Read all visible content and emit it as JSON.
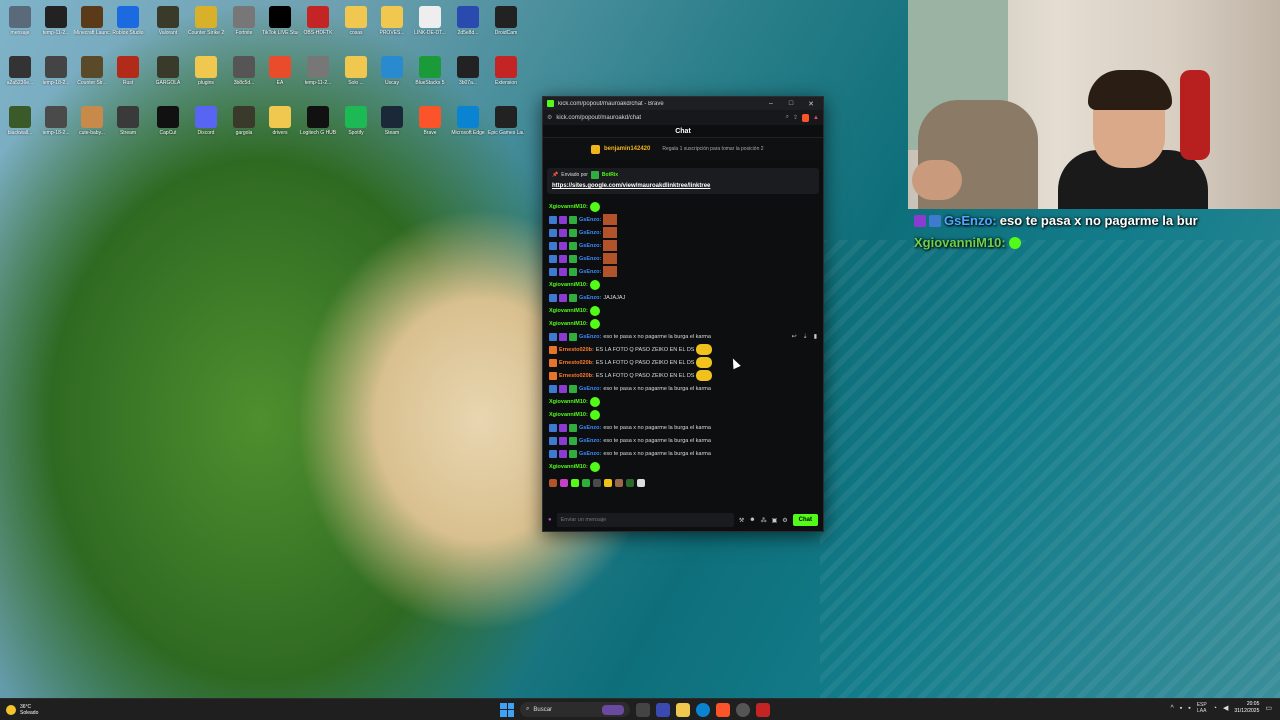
{
  "desktop": {
    "icons": [
      {
        "label": "mensaje",
        "color": "#5a6a7a"
      },
      {
        "label": "temp-11-2...",
        "color": "#222222"
      },
      {
        "label": "Minecraft Launcher",
        "color": "#5b3a1a"
      },
      {
        "label": "Roblox Studio",
        "color": "#1b6ae0"
      },
      {
        "label": "Valorant",
        "color": "#3a3a2a"
      },
      {
        "label": "Counter Strike 2",
        "color": "#d8b02a"
      },
      {
        "label": "Fortnite",
        "color": "#777777"
      },
      {
        "label": "TikTok LIVE Studio",
        "color": "#000000"
      },
      {
        "label": "OBS-HDFTK",
        "color": "#c42424"
      },
      {
        "label": "cosas",
        "color": "#f0c850"
      },
      {
        "label": "PROVES...",
        "color": "#f0c850"
      },
      {
        "label": "LINK-DE-DT...",
        "color": "#eeeeee"
      },
      {
        "label": "2d5e8d...",
        "color": "#2a4ab0"
      },
      {
        "label": "DroidCam",
        "color": "#222222"
      },
      {
        "label": "a2a5236e...",
        "color": "#333333"
      },
      {
        "label": "temp-18-2...",
        "color": "#444444"
      },
      {
        "label": "Counter Str...",
        "color": "#5a4a2a"
      },
      {
        "label": "Rust",
        "color": "#b22a1a"
      },
      {
        "label": "GARGOLA",
        "color": "#3a3a2a"
      },
      {
        "label": "plugins",
        "color": "#f0c850"
      },
      {
        "label": "3b8c5d...",
        "color": "#555555"
      },
      {
        "label": "EA",
        "color": "#e84c2a"
      },
      {
        "label": "temp-11-2...",
        "color": "#777777"
      },
      {
        "label": "Solo ...",
        "color": "#f0c850"
      },
      {
        "label": "Uscay",
        "color": "#2a8ad0"
      },
      {
        "label": "BlueStacks 5",
        "color": "#1b9a3a"
      },
      {
        "label": "3b07a...",
        "color": "#222222"
      },
      {
        "label": "Extension",
        "color": "#c42424"
      },
      {
        "label": "blackwall...",
        "color": "#3a5a2a"
      },
      {
        "label": "temp-18-2...",
        "color": "#4a4a4a"
      },
      {
        "label": "cute-baby...",
        "color": "#c88a4a"
      },
      {
        "label": "Stream",
        "color": "#3a3a3a"
      },
      {
        "label": "CapCut",
        "color": "#111111"
      },
      {
        "label": "Discord",
        "color": "#5865f2"
      },
      {
        "label": "gargola",
        "color": "#3a3a2a"
      },
      {
        "label": "drivers",
        "color": "#f0c850"
      },
      {
        "label": "Logitech G HUB",
        "color": "#111111"
      },
      {
        "label": "Spotify",
        "color": "#1db954"
      },
      {
        "label": "Steam",
        "color": "#1b2838"
      },
      {
        "label": "Brave",
        "color": "#fb542b"
      },
      {
        "label": "Microsoft Edge",
        "color": "#0a84d0"
      },
      {
        "label": "Epic Games Launcher",
        "color": "#222222"
      }
    ]
  },
  "webcam": {
    "overlay_lines": [
      {
        "user": "GsEnzo:",
        "text": "eso te pasa x no pagarme la bur"
      },
      {
        "user": "XgiovanniM10:",
        "text": ""
      }
    ]
  },
  "browser": {
    "title": "kick.com/popout/mauroakd/chat - Brave",
    "url": "kick.com/popout/mauroakd/chat",
    "controls": {
      "minimize": "–",
      "maximize": "□",
      "close": "✕"
    }
  },
  "chat": {
    "header": "Chat",
    "goal": {
      "user": "benjamin142420",
      "text": "Regala 1 suscripción para tomar la posición 2"
    },
    "pinned": {
      "by_label": "Enviado por",
      "bot": "BotRix",
      "link": "https://sites.google.com/view/mauroakdlinktree/linktree"
    },
    "messages": [
      {
        "user": "XgiovanniM10:",
        "text": "",
        "kind": "green-emote"
      },
      {
        "user": "GsEnzo:",
        "text": "",
        "kind": "blue-img"
      },
      {
        "user": "GsEnzo:",
        "text": "",
        "kind": "blue-img"
      },
      {
        "user": "GsEnzo:",
        "text": "",
        "kind": "blue-img"
      },
      {
        "user": "GsEnzo:",
        "text": "",
        "kind": "blue-img"
      },
      {
        "user": "GsEnzo:",
        "text": "",
        "kind": "blue-img"
      },
      {
        "user": "XgiovanniM10:",
        "text": "",
        "kind": "green-emote"
      },
      {
        "user": "GsEnzo:",
        "text": "JAJAJAJ",
        "kind": "blue"
      },
      {
        "user": "XgiovanniM10:",
        "text": "",
        "kind": "green-emote"
      },
      {
        "user": "XgiovanniM10:",
        "text": "",
        "kind": "green-emote"
      },
      {
        "user": "GsEnzo:",
        "text": "eso te pasa x no pagarme la burga el karma",
        "kind": "blue-actions"
      },
      {
        "user": "Ernesto020b:",
        "text": "ES LA FOTO Q PASO ZEIKO EN EL DS",
        "kind": "orange"
      },
      {
        "user": "Ernesto020b:",
        "text": "ES LA FOTO Q PASO ZEIKO EN EL DS",
        "kind": "orange"
      },
      {
        "user": "Ernesto020b:",
        "text": "ES LA FOTO Q PASO ZEIKO EN EL DS",
        "kind": "orange"
      },
      {
        "user": "GsEnzo:",
        "text": "eso te pasa x no pagarme la burga el karma",
        "kind": "blue"
      },
      {
        "user": "XgiovanniM10:",
        "text": "",
        "kind": "green-emote"
      },
      {
        "user": "XgiovanniM10:",
        "text": "",
        "kind": "green-emote"
      },
      {
        "user": "GsEnzo:",
        "text": "eso te pasa x no pagarme la burga el karma",
        "kind": "blue"
      },
      {
        "user": "GsEnzo:",
        "text": "eso te pasa x no pagarme la burga el karma",
        "kind": "blue"
      },
      {
        "user": "GsEnzo:",
        "text": "eso te pasa x no pagarme la burga el karma",
        "kind": "blue"
      },
      {
        "user": "XgiovanniM10:",
        "text": "",
        "kind": "green-emote"
      }
    ],
    "input_placeholder": "Enviar un mensaje",
    "send_label": "Chat"
  },
  "taskbar": {
    "weather_temp": "36°C",
    "weather_text": "Soleado",
    "search_label": "Buscar",
    "lang_top": "ESP",
    "lang_bottom": "LAA",
    "time": "20:05",
    "date": "31/12/2025"
  }
}
